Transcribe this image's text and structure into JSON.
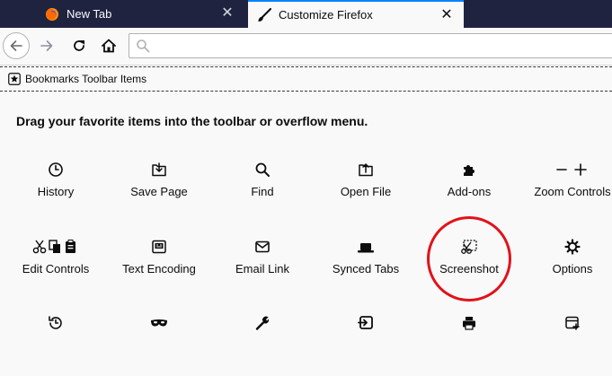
{
  "tabs": [
    {
      "label": "New Tab",
      "icon": "firefox-logo-icon",
      "active": false,
      "close": "✕"
    },
    {
      "label": "Customize Firefox",
      "icon": "paintbrush-icon",
      "active": true,
      "close": "✕"
    }
  ],
  "toolbar": {
    "back": "back-arrow-icon",
    "forward": "forward-arrow-icon",
    "reload": "reload-icon",
    "home": "home-icon",
    "search": "search-icon"
  },
  "bookmarks": {
    "label": "Bookmarks Toolbar Items",
    "icon": "star-icon"
  },
  "palette": {
    "heading": "Drag your favorite items into the toolbar or overflow menu.",
    "row1": [
      {
        "label": "History",
        "icon": "clock-icon"
      },
      {
        "label": "Save Page",
        "icon": "save-page-icon"
      },
      {
        "label": "Find",
        "icon": "search-icon"
      },
      {
        "label": "Open File",
        "icon": "open-file-icon"
      },
      {
        "label": "Add-ons",
        "icon": "puzzle-icon"
      },
      {
        "label": "Zoom Controls",
        "icon": "zoom-icon"
      }
    ],
    "row2": [
      {
        "label": "Edit Controls",
        "icon": "cut-copy-paste-icon"
      },
      {
        "label": "Text Encoding",
        "icon": "text-encoding-icon"
      },
      {
        "label": "Email Link",
        "icon": "mail-icon"
      },
      {
        "label": "Synced Tabs",
        "icon": "laptop-icon"
      },
      {
        "label": "Screenshot",
        "icon": "screenshot-icon"
      },
      {
        "label": "Options",
        "icon": "gear-icon"
      }
    ],
    "row3": [
      {
        "icon": "history-restore-icon"
      },
      {
        "icon": "private-mask-icon"
      },
      {
        "icon": "wrench-icon"
      },
      {
        "icon": "new-window-icon"
      },
      {
        "icon": "printer-icon"
      },
      {
        "icon": "sidebar-add-icon"
      }
    ]
  },
  "annotation": {
    "type": "circle",
    "color": "#e1121a",
    "target": "Screenshot"
  },
  "colors": {
    "tabstrip": "#202340",
    "accent": "#0a84ff",
    "page": "#f9f9fa"
  }
}
